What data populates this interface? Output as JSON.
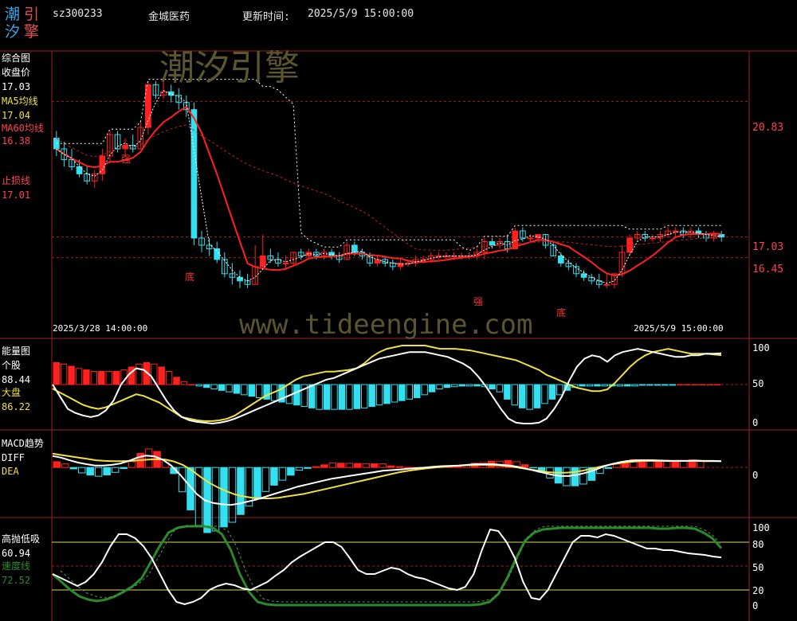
{
  "header": {
    "logo": [
      "潮",
      "引",
      "汐",
      "擎"
    ],
    "code": "sz300233",
    "name": "金城医药",
    "update_label": "更新时间:",
    "update_time": "2025/5/9 15:00:00"
  },
  "watermark": {
    "main": "潮汐引擎",
    "url": "www.tideengine.com"
  },
  "colors": {
    "bg": "#000000",
    "up": "#ff2020",
    "down": "#33e0f0",
    "white": "#ffffff",
    "yellow": "#f0e040",
    "green": "#2a8a2a",
    "grid_red": "#a02020",
    "pink": "#ff4050",
    "watermark": "#5a5430"
  },
  "panels": {
    "main": {
      "title": "综合图",
      "close_label": "收盘价",
      "close_value": "17.03",
      "ma5_label": "MA5均线",
      "ma5_value": "17.04",
      "ma60_label": "MA60均线",
      "ma60_value": "16.38",
      "stop_label": "止损线",
      "stop_value": "17.01",
      "right_ticks": [
        "20.83",
        "17.03",
        "16.45"
      ],
      "date_left": "2025/3/28 14:00:00",
      "date_right": "2025/5/9 15:00:00",
      "marks": [
        "强",
        "底",
        "强",
        "底"
      ]
    },
    "energy": {
      "title": "能量图",
      "stock_label": "个股",
      "stock_value": "88.44",
      "market_label": "大盘",
      "market_value": "86.22",
      "right_ticks": [
        "100",
        "50",
        "0"
      ]
    },
    "macd": {
      "title": "MACD趋势",
      "diff_label": "DIFF",
      "dea_label": "DEA",
      "right_ticks": [
        "0"
      ]
    },
    "osc": {
      "title": "高抛低吸",
      "value": "60.94",
      "speed_label": "速度线",
      "speed_value": "72.52",
      "right_ticks": [
        "100",
        "80",
        "50",
        "20",
        "0"
      ]
    }
  },
  "chart_data": [
    {
      "type": "candlestick",
      "title": "综合图",
      "ylim": [
        14.3,
        22.2
      ],
      "right_ticks": [
        20.83,
        17.03,
        16.45
      ],
      "candles_ohlc": [
        [
          19.8,
          20.0,
          19.3,
          19.5
        ],
        [
          19.5,
          19.7,
          19.0,
          19.2
        ],
        [
          19.2,
          19.5,
          18.9,
          19.0
        ],
        [
          19.0,
          19.2,
          18.7,
          18.8
        ],
        [
          18.8,
          19.0,
          18.5,
          18.6
        ],
        [
          18.6,
          18.9,
          18.4,
          18.8
        ],
        [
          18.8,
          19.5,
          18.6,
          19.3
        ],
        [
          19.3,
          20.0,
          19.1,
          19.9
        ],
        [
          19.9,
          20.0,
          19.4,
          19.5
        ],
        [
          19.5,
          19.8,
          19.3,
          19.6
        ],
        [
          19.6,
          19.9,
          19.4,
          19.5
        ],
        [
          19.5,
          20.3,
          19.5,
          20.1
        ],
        [
          20.1,
          21.4,
          19.9,
          21.3
        ],
        [
          21.3,
          21.4,
          20.9,
          21.0
        ],
        [
          21.0,
          21.5,
          20.9,
          21.1
        ],
        [
          21.1,
          21.3,
          20.8,
          21.0
        ],
        [
          21.0,
          21.2,
          20.6,
          20.8
        ],
        [
          20.8,
          21.0,
          20.4,
          20.6
        ],
        [
          20.6,
          20.8,
          16.8,
          17.0
        ],
        [
          17.0,
          17.2,
          16.6,
          16.8
        ],
        [
          16.8,
          17.0,
          16.5,
          16.7
        ],
        [
          16.7,
          16.9,
          16.3,
          16.4
        ],
        [
          16.4,
          16.6,
          15.9,
          16.0
        ],
        [
          16.0,
          16.3,
          15.7,
          15.9
        ],
        [
          15.9,
          16.1,
          15.6,
          15.8
        ],
        [
          15.8,
          16.0,
          15.6,
          15.7
        ],
        [
          15.7,
          16.8,
          15.7,
          16.2
        ],
        [
          16.2,
          17.1,
          16.1,
          16.5
        ],
        [
          16.5,
          16.7,
          16.3,
          16.4
        ],
        [
          16.4,
          16.6,
          16.2,
          16.3
        ],
        [
          16.3,
          16.5,
          16.1,
          16.3
        ],
        [
          16.3,
          16.6,
          16.2,
          16.6
        ],
        [
          16.6,
          16.7,
          16.4,
          16.5
        ],
        [
          16.5,
          16.7,
          16.4,
          16.6
        ],
        [
          16.6,
          16.7,
          16.4,
          16.5
        ],
        [
          16.5,
          16.7,
          16.4,
          16.6
        ],
        [
          16.6,
          16.7,
          16.4,
          16.5
        ],
        [
          16.5,
          16.6,
          16.3,
          16.4
        ],
        [
          16.4,
          16.9,
          16.4,
          16.8
        ],
        [
          16.8,
          16.9,
          16.5,
          16.6
        ],
        [
          16.6,
          16.7,
          16.4,
          16.5
        ],
        [
          16.5,
          16.6,
          16.2,
          16.3
        ],
        [
          16.3,
          16.5,
          16.2,
          16.4
        ],
        [
          16.4,
          16.5,
          16.2,
          16.3
        ],
        [
          16.3,
          16.4,
          16.1,
          16.2
        ],
        [
          16.2,
          16.4,
          16.1,
          16.3
        ],
        [
          16.3,
          16.4,
          16.2,
          16.3
        ],
        [
          16.3,
          16.5,
          16.2,
          16.4
        ],
        [
          16.4,
          16.5,
          16.3,
          16.4
        ],
        [
          16.4,
          16.6,
          16.3,
          16.5
        ],
        [
          16.5,
          16.6,
          16.4,
          16.5
        ],
        [
          16.5,
          16.6,
          16.4,
          16.5
        ],
        [
          16.5,
          16.6,
          16.4,
          16.5
        ],
        [
          16.5,
          16.6,
          16.4,
          16.5
        ],
        [
          16.5,
          16.6,
          16.4,
          16.5
        ],
        [
          16.5,
          16.7,
          16.4,
          16.6
        ],
        [
          16.6,
          17.0,
          16.4,
          16.9
        ],
        [
          16.9,
          17.0,
          16.7,
          16.8
        ],
        [
          16.8,
          17.0,
          16.7,
          16.9
        ],
        [
          16.9,
          17.1,
          16.6,
          16.7
        ],
        [
          16.7,
          17.3,
          16.7,
          17.2
        ],
        [
          17.2,
          17.3,
          16.9,
          17.0
        ],
        [
          17.0,
          17.1,
          16.9,
          17.0
        ],
        [
          17.0,
          17.1,
          16.9,
          17.1
        ],
        [
          17.1,
          17.1,
          16.7,
          16.8
        ],
        [
          16.8,
          16.9,
          16.5,
          16.5
        ],
        [
          16.5,
          16.6,
          16.2,
          16.3
        ],
        [
          16.3,
          16.4,
          16.1,
          16.2
        ],
        [
          16.2,
          16.3,
          15.9,
          16.0
        ],
        [
          16.0,
          16.1,
          15.8,
          15.9
        ],
        [
          15.9,
          16.0,
          15.7,
          15.8
        ],
        [
          15.8,
          16.0,
          15.6,
          15.7
        ],
        [
          15.7,
          16.0,
          15.6,
          15.7
        ],
        [
          15.7,
          16.0,
          15.6,
          16.0
        ],
        [
          16.0,
          16.8,
          15.9,
          16.6
        ],
        [
          16.6,
          17.1,
          16.5,
          17.0
        ],
        [
          17.0,
          17.2,
          16.9,
          17.1
        ],
        [
          17.1,
          17.2,
          16.9,
          17.0
        ],
        [
          17.0,
          17.1,
          16.9,
          17.0
        ],
        [
          17.0,
          17.2,
          16.9,
          17.1
        ],
        [
          17.1,
          17.3,
          17.0,
          17.2
        ],
        [
          17.2,
          17.3,
          17.0,
          17.2
        ],
        [
          17.2,
          17.3,
          17.0,
          17.1
        ],
        [
          17.1,
          17.3,
          17.0,
          17.2
        ],
        [
          17.2,
          17.3,
          17.0,
          17.1
        ],
        [
          17.1,
          17.2,
          16.9,
          17.0
        ],
        [
          17.0,
          17.2,
          16.9,
          17.1
        ],
        [
          17.1,
          17.2,
          16.9,
          17.03
        ]
      ]
    },
    {
      "type": "bar+line",
      "title": "能量图",
      "ylim": [
        0,
        100
      ],
      "series": [
        {
          "name": "个股",
          "values": [
            50,
            35,
            20,
            15,
            12,
            10,
            12,
            18,
            30,
            50,
            62,
            70,
            68,
            60,
            45,
            30,
            18,
            10,
            6,
            4,
            3,
            2,
            3,
            5,
            8,
            12,
            16,
            20,
            24,
            28,
            32,
            36,
            40,
            44,
            48,
            52,
            56,
            58,
            62,
            66,
            70,
            74,
            78,
            82,
            84,
            86,
            88,
            90,
            90,
            90,
            88,
            86,
            84,
            80,
            76,
            70,
            60,
            48,
            34,
            20,
            8,
            3,
            2,
            2,
            3,
            8,
            20,
            35,
            55,
            72,
            82,
            86,
            84,
            78,
            86,
            90,
            92,
            94,
            92,
            90,
            88,
            86,
            84,
            84,
            86,
            86,
            88,
            88,
            88.44
          ]
        },
        {
          "name": "大盘",
          "values": [
            45,
            40,
            35,
            30,
            25,
            22,
            20,
            22,
            26,
            30,
            34,
            38,
            36,
            32,
            28,
            22,
            16,
            10,
            8,
            6,
            5,
            5,
            6,
            8,
            12,
            18,
            24,
            30,
            36,
            40,
            44,
            50,
            56,
            60,
            62,
            64,
            66,
            66,
            67,
            68,
            70,
            76,
            84,
            90,
            94,
            96,
            98,
            98,
            98,
            98,
            96,
            94,
            94,
            94,
            93,
            92,
            90,
            88,
            86,
            84,
            82,
            80,
            76,
            72,
            68,
            62,
            58,
            54,
            50,
            46,
            44,
            42,
            42,
            44,
            52,
            62,
            72,
            80,
            86,
            90,
            92,
            94,
            92,
            90,
            88,
            88,
            88,
            87,
            86.22
          ]
        },
        {
          "name": "bars",
          "values": [
            30,
            28,
            25,
            22,
            20,
            18,
            18,
            18,
            18,
            20,
            24,
            28,
            30,
            28,
            24,
            18,
            10,
            4,
            0,
            -2,
            -4,
            -6,
            -8,
            -10,
            -12,
            -14,
            -16,
            -18,
            -20,
            -22,
            -24,
            -26,
            -28,
            -30,
            -32,
            -34,
            -34,
            -34,
            -34,
            -34,
            -33,
            -32,
            -30,
            -28,
            -26,
            -24,
            -22,
            -20,
            -18,
            -14,
            -10,
            -6,
            -4,
            -3,
            -2,
            -2,
            -2,
            -3,
            -6,
            -10,
            -20,
            -28,
            -32,
            -34,
            -32,
            -26,
            -20,
            -14,
            -8,
            -4,
            -2,
            -2,
            -2,
            -2,
            -2,
            -2,
            -2,
            -2,
            -1,
            -1,
            -1,
            -1,
            -1,
            0,
            0,
            0,
            0,
            0,
            0
          ]
        }
      ]
    },
    {
      "type": "bar+line",
      "title": "MACD趋势",
      "ylim": [
        -1.4,
        0.9
      ],
      "series": [
        {
          "name": "DIFF",
          "values": [
            0.35,
            0.3,
            0.22,
            0.15,
            0.1,
            0.06,
            0.06,
            0.08,
            0.12,
            0.2,
            0.3,
            0.36,
            0.34,
            0.24,
            0.06,
            -0.2,
            -0.5,
            -0.8,
            -1.0,
            -1.08,
            -1.12,
            -1.14,
            -1.1,
            -1.04,
            -0.98,
            -0.9,
            -0.82,
            -0.74,
            -0.66,
            -0.58,
            -0.52,
            -0.46,
            -0.4,
            -0.34,
            -0.3,
            -0.26,
            -0.22,
            -0.18,
            -0.14,
            -0.1,
            -0.08,
            -0.06,
            -0.04,
            -0.02,
            0.0,
            0.02,
            0.04,
            0.05,
            0.06,
            0.08,
            0.1,
            0.1,
            0.1,
            0.08,
            0.06,
            0.02,
            -0.04,
            -0.1,
            -0.16,
            -0.22,
            -0.26,
            -0.26,
            -0.22,
            -0.16,
            -0.08,
            0.02,
            0.1,
            0.16,
            0.2,
            0.22,
            0.22,
            0.22,
            0.21,
            0.2,
            0.2,
            0.2,
            0.21,
            0.2,
            0.2,
            0.19
          ]
        },
        {
          "name": "DEA",
          "values": [
            0.42,
            0.38,
            0.34,
            0.3,
            0.26,
            0.22,
            0.2,
            0.19,
            0.19,
            0.2,
            0.22,
            0.24,
            0.25,
            0.24,
            0.18,
            0.08,
            -0.08,
            -0.28,
            -0.46,
            -0.6,
            -0.72,
            -0.82,
            -0.88,
            -0.92,
            -0.94,
            -0.94,
            -0.92,
            -0.88,
            -0.84,
            -0.8,
            -0.74,
            -0.68,
            -0.62,
            -0.56,
            -0.5,
            -0.44,
            -0.38,
            -0.32,
            -0.26,
            -0.2,
            -0.14,
            -0.1,
            -0.06,
            -0.03,
            0.0,
            0.02,
            0.04,
            0.06,
            0.07,
            0.08,
            0.08,
            0.07,
            0.05,
            0.02,
            -0.02,
            -0.06,
            -0.1,
            -0.14,
            -0.16,
            -0.16,
            -0.14,
            -0.1,
            -0.04,
            0.02,
            0.08,
            0.12,
            0.16,
            0.18,
            0.2,
            0.2,
            0.2,
            0.2,
            0.2,
            0.2,
            0.2,
            0.19,
            0.19,
            0.19
          ]
        }
      ]
    },
    {
      "type": "line",
      "title": "高抛低吸",
      "ylim": [
        0,
        100
      ],
      "right_ticks": [
        100,
        80,
        50,
        20,
        0
      ],
      "series": [
        {
          "name": "高抛低吸",
          "values": [
            40,
            35,
            30,
            25,
            30,
            40,
            55,
            75,
            90,
            90,
            85,
            75,
            60,
            40,
            20,
            5,
            2,
            5,
            10,
            20,
            25,
            28,
            26,
            22,
            20,
            25,
            30,
            38,
            45,
            55,
            62,
            68,
            74,
            80,
            80,
            74,
            60,
            45,
            40,
            40,
            44,
            48,
            46,
            40,
            36,
            34,
            30,
            26,
            22,
            20,
            24,
            40,
            70,
            96,
            94,
            80,
            60,
            30,
            10,
            8,
            20,
            40,
            60,
            80,
            88,
            88,
            86,
            90,
            88,
            84,
            80,
            76,
            72,
            72,
            70,
            70,
            68,
            66,
            65,
            64,
            62,
            60.94
          ]
        },
        {
          "name": "速度线",
          "values": [
            40,
            30,
            20,
            12,
            8,
            6,
            8,
            12,
            18,
            25,
            35,
            55,
            75,
            92,
            98,
            100,
            100,
            100,
            98,
            90,
            70,
            40,
            18,
            5,
            2,
            1,
            1,
            1,
            1,
            1,
            1,
            1,
            1,
            1,
            1,
            1,
            1,
            1,
            1,
            1,
            1,
            1,
            1,
            1,
            1,
            1,
            1,
            1,
            2,
            5,
            15,
            35,
            60,
            82,
            92,
            96,
            97,
            98,
            98,
            98,
            98,
            98,
            98,
            98,
            98,
            98,
            98,
            98,
            97,
            97,
            98,
            98,
            97,
            92,
            85,
            72.52
          ]
        }
      ]
    }
  ]
}
